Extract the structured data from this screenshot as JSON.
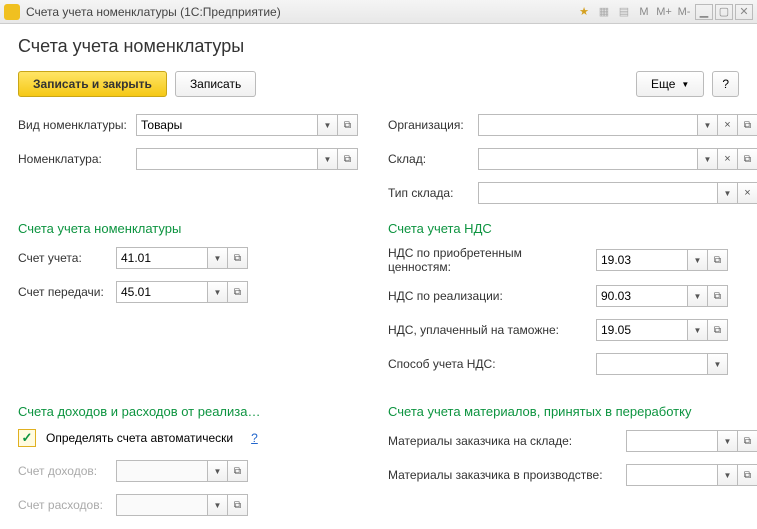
{
  "window": {
    "title": "Счета учета номенклатуры  (1С:Предприятие)",
    "heading": "Счета учета номенклатуры"
  },
  "toolbar": {
    "save_close": "Записать и закрыть",
    "save": "Записать",
    "more": "Еще",
    "help": "?"
  },
  "left": {
    "kind_label": "Вид номенклатуры:",
    "kind_value": "Товары",
    "nomen_label": "Номенклатура:",
    "nomen_value": ""
  },
  "right": {
    "org_label": "Организация:",
    "org_value": "",
    "warehouse_label": "Склад:",
    "warehouse_value": "",
    "whtype_label": "Тип склада:",
    "whtype_value": ""
  },
  "accounts": {
    "title": "Счета учета номенклатуры",
    "acct_label": "Счет учета:",
    "acct_value": "41.01",
    "transfer_label": "Счет передачи:",
    "transfer_value": "45.01"
  },
  "nds": {
    "title": "Счета учета НДС",
    "purchase_label": "НДС по приобретенным ценностям:",
    "purchase_value": "19.03",
    "sales_label": "НДС по реализации:",
    "sales_value": "90.03",
    "customs_label": "НДС, уплаченный на таможне:",
    "customs_value": "19.05",
    "method_label": "Способ учета НДС:",
    "method_value": ""
  },
  "income": {
    "title": "Счета доходов и расходов от реализа…",
    "auto_label": "Определять счета автоматически",
    "help": "?",
    "income_label": "Счет доходов:",
    "income_value": "",
    "expense_label": "Счет расходов:",
    "expense_value": ""
  },
  "materials": {
    "title": "Счета учета материалов, принятых в переработку",
    "stock_label": "Материалы заказчика на складе:",
    "stock_value": "",
    "prod_label": "Материалы заказчика в производстве:",
    "prod_value": ""
  },
  "tbicons": {
    "m": "M",
    "mp": "M+",
    "mm": "M-"
  }
}
